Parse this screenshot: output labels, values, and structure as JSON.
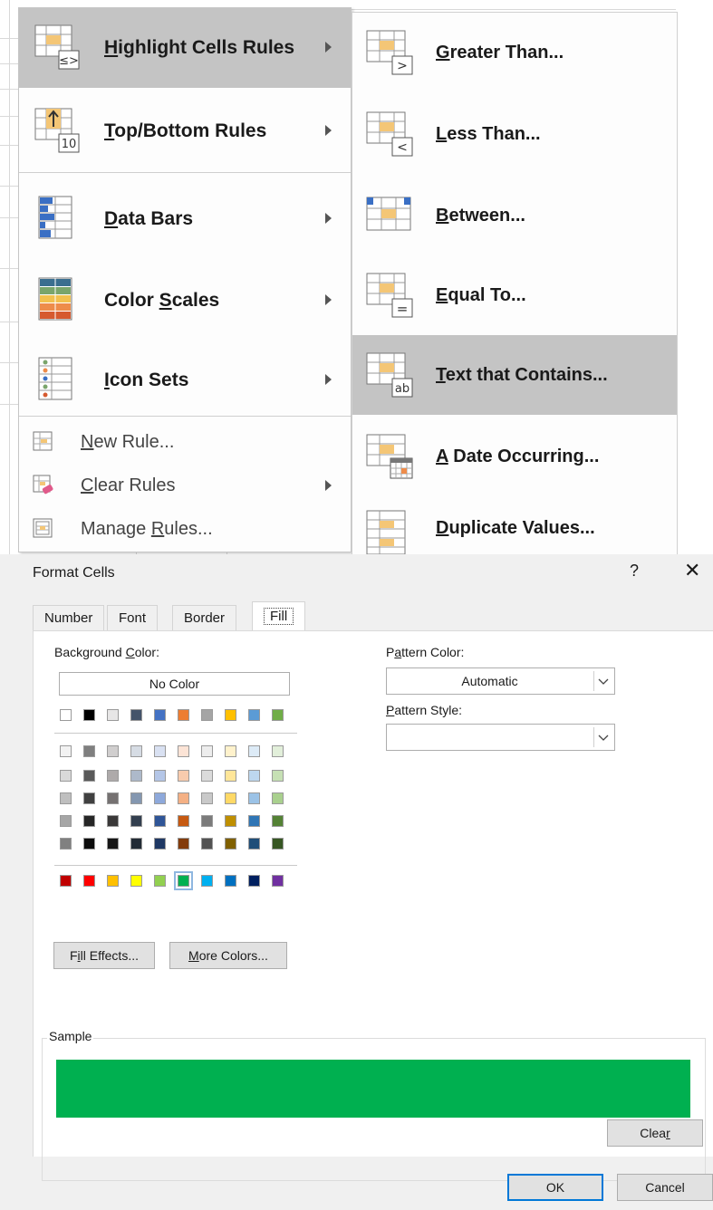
{
  "menu": {
    "items": [
      {
        "label_u": "H",
        "label_rest": "ighlight Cells Rules",
        "icon": "highlight-cells-icon",
        "has_submenu": true,
        "highlighted": true
      },
      {
        "label_u": "T",
        "label_rest": "op/Bottom Rules",
        "icon": "top-bottom-icon",
        "has_submenu": true
      },
      {
        "label_u": "D",
        "label_rest": "ata Bars",
        "icon": "data-bars-icon",
        "has_submenu": true
      },
      {
        "label_pre": "Color ",
        "label_u": "S",
        "label_rest": "cales",
        "icon": "color-scales-icon",
        "has_submenu": true
      },
      {
        "label_u": "I",
        "label_rest": "con Sets",
        "icon": "icon-sets-icon",
        "has_submenu": true
      }
    ],
    "small_items": [
      {
        "label_u": "N",
        "label_rest": "ew Rule...",
        "icon": "new-rule-icon"
      },
      {
        "label_u": "C",
        "label_rest": "lear Rules",
        "icon": "clear-rules-icon",
        "has_submenu": true
      },
      {
        "label_pre": "Manage ",
        "label_u": "R",
        "label_rest": "ules...",
        "icon": "manage-rules-icon"
      }
    ],
    "top_bottom_badge": "10"
  },
  "submenu": {
    "items": [
      {
        "label_u": "G",
        "label_rest": "reater Than...",
        "badge": ">"
      },
      {
        "label_u": "L",
        "label_rest": "ess Than...",
        "badge": "<"
      },
      {
        "label_u": "B",
        "label_rest": "etween..."
      },
      {
        "label_u": "E",
        "label_rest": "qual To...",
        "badge": "="
      },
      {
        "label_u": "T",
        "label_rest": "ext that Contains...",
        "badge": "ab",
        "highlighted": true
      },
      {
        "label_u": "A",
        "label_rest": " Date Occurring..."
      },
      {
        "label_u": "D",
        "label_rest": "uplicate Values..."
      }
    ]
  },
  "dialog": {
    "title": "Format Cells",
    "help": "?",
    "close": "✕",
    "tabs": [
      "Number",
      "Font",
      "Border",
      "Fill"
    ],
    "active_tab": "Fill",
    "bg_color_label_pre": "Background ",
    "bg_color_label_u": "C",
    "bg_color_label_rest": "olor:",
    "no_color": "No Color",
    "pattern_color_label_pre": "P",
    "pattern_color_label_u": "a",
    "pattern_color_label_rest": "ttern Color:",
    "pattern_color_value": "Automatic",
    "pattern_style_label_u": "P",
    "pattern_style_label_rest": "attern Style:",
    "pattern_style_value": "",
    "fill_effects_pre": "F",
    "fill_effects_u": "i",
    "fill_effects_rest": "ll Effects...",
    "more_colors_u": "M",
    "more_colors_rest": "ore Colors...",
    "sample_label": "Sample",
    "sample_color": "#00b050",
    "clear_pre": "Clea",
    "clear_u": "r",
    "ok": "OK",
    "cancel": "Cancel",
    "theme_top": [
      "#ffffff",
      "#000000",
      "#e7e6e6",
      "#44546a",
      "#4472c4",
      "#ed7d31",
      "#a5a5a5",
      "#ffc000",
      "#5b9bd5",
      "#70ad47"
    ],
    "theme_tints": [
      [
        "#f2f2f2",
        "#7f7f7f",
        "#d0cece",
        "#d6dce4",
        "#d9e1f2",
        "#fce4d6",
        "#ededed",
        "#fff2cc",
        "#ddebf7",
        "#e2efda"
      ],
      [
        "#d9d9d9",
        "#595959",
        "#aeaaaa",
        "#adb9ca",
        "#b4c6e7",
        "#f8cbad",
        "#dbdbdb",
        "#ffe699",
        "#bdd7ee",
        "#c6e0b4"
      ],
      [
        "#bfbfbf",
        "#404040",
        "#757171",
        "#8497b0",
        "#8ea9db",
        "#f4b084",
        "#c9c9c9",
        "#ffd966",
        "#9bc2e6",
        "#a9d08e"
      ],
      [
        "#a6a6a6",
        "#262626",
        "#3a3838",
        "#333f4f",
        "#2f5597",
        "#c65911",
        "#7b7b7b",
        "#bf8f00",
        "#2f75b5",
        "#548235"
      ],
      [
        "#808080",
        "#0d0d0d",
        "#161616",
        "#222b35",
        "#1f3864",
        "#833c0c",
        "#525252",
        "#806000",
        "#1f4e78",
        "#375623"
      ]
    ],
    "standard": [
      "#c00000",
      "#ff0000",
      "#ffc000",
      "#ffff00",
      "#92d050",
      "#00b050",
      "#00b0f0",
      "#0070c0",
      "#002060",
      "#7030a0"
    ],
    "selected_standard_index": 5
  }
}
